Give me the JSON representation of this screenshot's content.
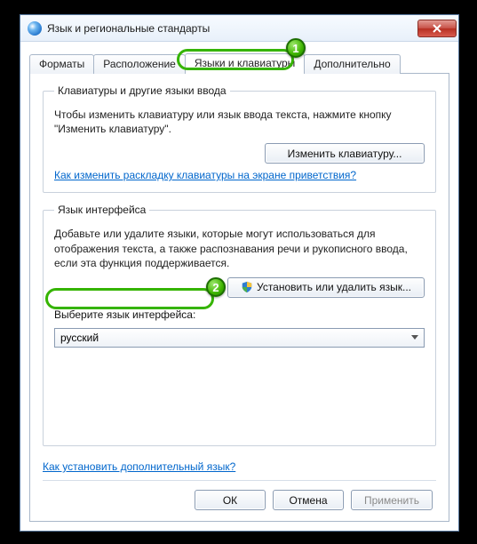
{
  "window": {
    "title": "Язык и региональные стандарты"
  },
  "tabs": {
    "formats": "Форматы",
    "location": "Расположение",
    "keyboards": "Языки и клавиатуры",
    "advanced": "Дополнительно"
  },
  "group_keyboards": {
    "legend": "Клавиатуры и другие языки ввода",
    "desc": "Чтобы изменить клавиатуру или язык ввода текста, нажмите кнопку \"Изменить клавиатуру\".",
    "button": "Изменить клавиатуру...",
    "link": "Как изменить раскладку клавиатуры на экране приветствия?"
  },
  "group_display": {
    "legend": "Язык интерфейса",
    "desc": "Добавьте или удалите языки, которые могут использоваться для отображения текста, а также распознавания речи и рукописного ввода, если эта функция поддерживается.",
    "install_button": "Установить или удалить язык...",
    "choose_label": "Выберите язык интерфейса:",
    "selected": "русский"
  },
  "bottom_link": "Как установить дополнительный язык?",
  "footer": {
    "ok": "ОК",
    "cancel": "Отмена",
    "apply": "Применить"
  },
  "callouts": {
    "one": "1",
    "two": "2"
  }
}
